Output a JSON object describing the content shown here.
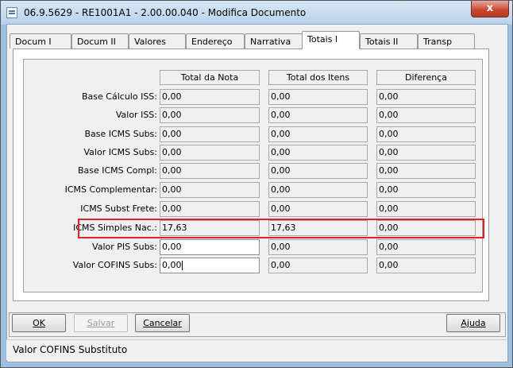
{
  "window": {
    "title": "06.9.5629 - RE1001A1 - 2.00.00.040 - Modifica Documento",
    "close_glyph": "x"
  },
  "tabs": [
    {
      "label": "Docum I"
    },
    {
      "label": "Docum II"
    },
    {
      "label": "Valores"
    },
    {
      "label": "Endereço"
    },
    {
      "label": "Narrativa"
    },
    {
      "label": "Totais I"
    },
    {
      "label": "Totais II"
    },
    {
      "label": "Transp"
    }
  ],
  "active_tab": "Totais I",
  "columns": [
    "Total da Nota",
    "Total dos Itens",
    "Diferença"
  ],
  "rows": [
    {
      "label": "Base Cálculo ISS:",
      "values": [
        "0,00",
        "0,00",
        "0,00"
      ]
    },
    {
      "label": "Valor ISS:",
      "values": [
        "0,00",
        "0,00",
        "0,00"
      ]
    },
    {
      "label": "Base ICMS Subs:",
      "values": [
        "0,00",
        "0,00",
        "0,00"
      ]
    },
    {
      "label": "Valor ICMS Subs:",
      "values": [
        "0,00",
        "0,00",
        "0,00"
      ]
    },
    {
      "label": "Base ICMS Compl:",
      "values": [
        "0,00",
        "0,00",
        "0,00"
      ]
    },
    {
      "label": "ICMS Complementar:",
      "values": [
        "0,00",
        "0,00",
        "0,00"
      ]
    },
    {
      "label": "ICMS Subst Frete:",
      "values": [
        "0,00",
        "0,00",
        "0,00"
      ]
    },
    {
      "label": "ICMS Simples Nac.:",
      "values": [
        "17,63",
        "17,63",
        "0,00"
      ]
    },
    {
      "label": "Valor PIS Subs:",
      "values": [
        "0,00",
        "0,00",
        "0,00"
      ]
    },
    {
      "label": "Valor COFINS Subs:",
      "values": [
        "0,00",
        "0,00",
        "0,00"
      ]
    }
  ],
  "buttons": {
    "ok": "OK",
    "save": "Salvar",
    "cancel": "Cancelar",
    "help": "Ajuda"
  },
  "status": "Valor COFINS Substituto",
  "colors": {
    "highlight": "#e0202a",
    "title_bar": "#b9d2ec",
    "close": "#c9452e"
  }
}
